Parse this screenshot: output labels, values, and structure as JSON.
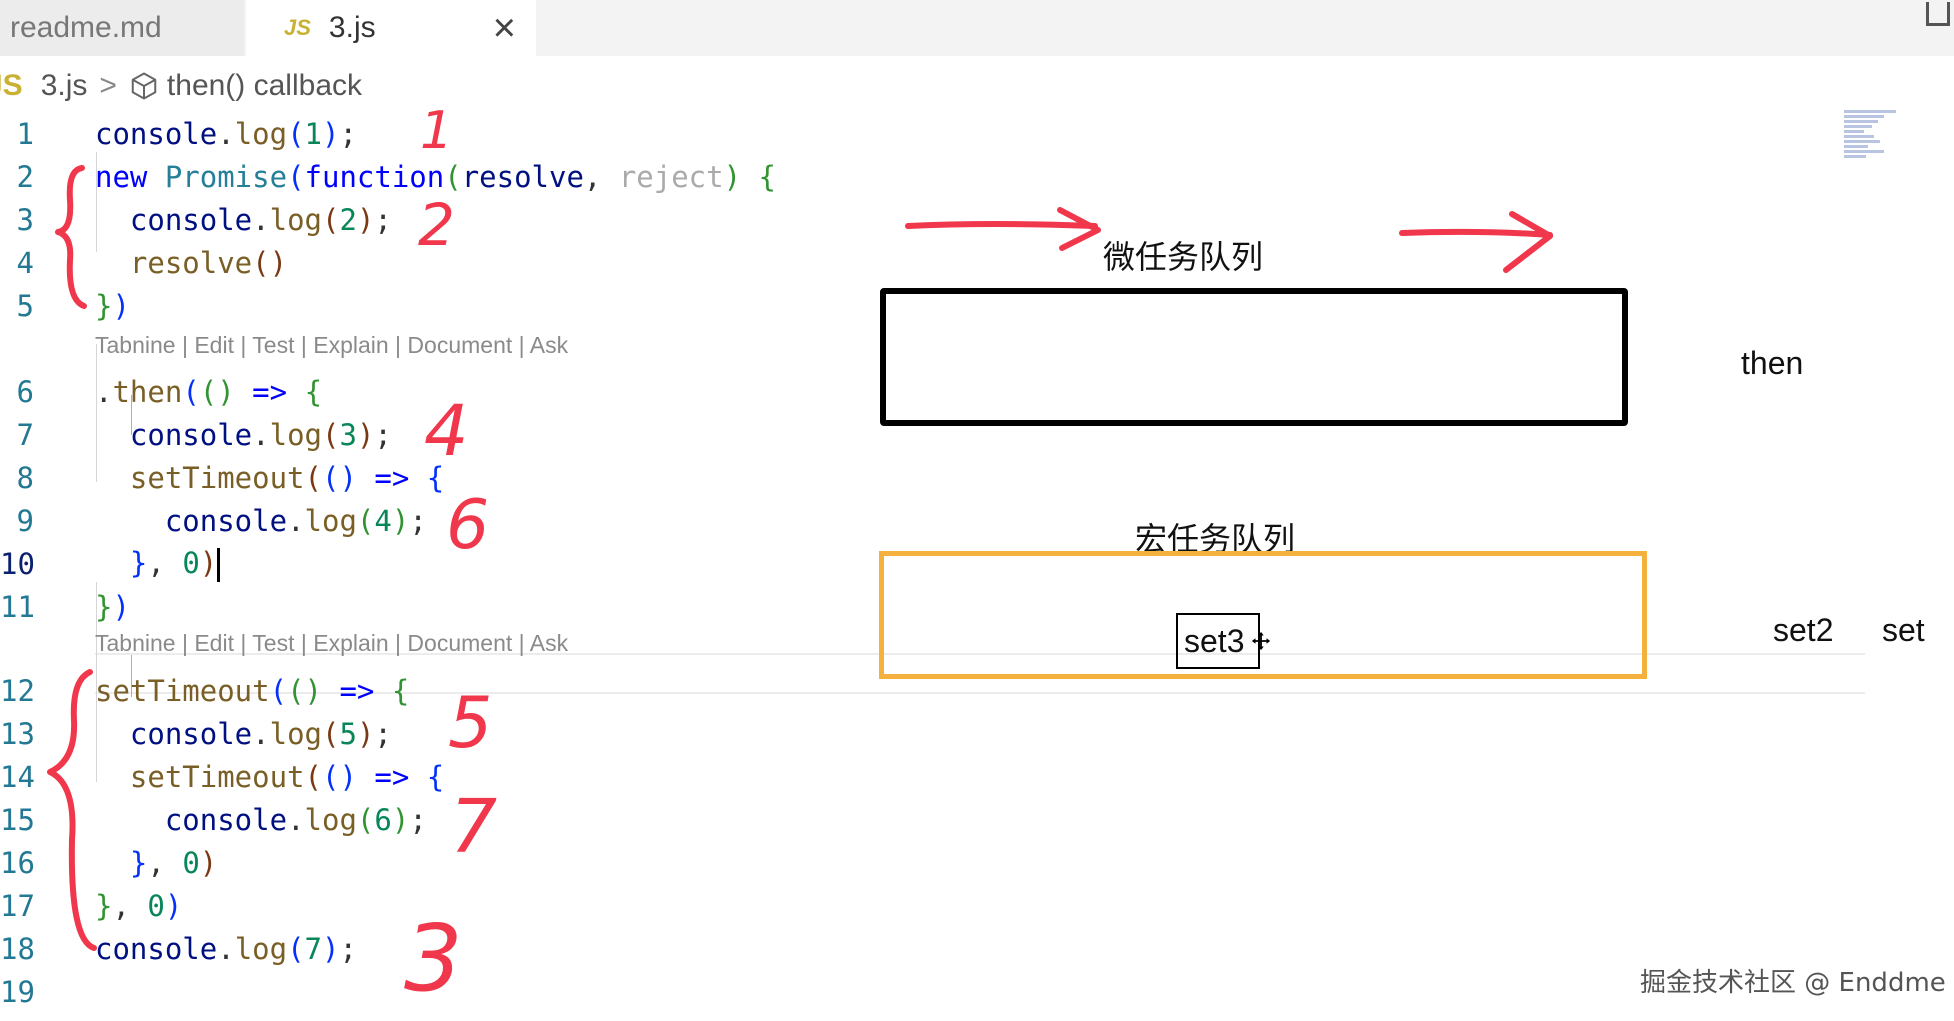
{
  "tabs": [
    {
      "label": "readme.md"
    },
    {
      "badge": "JS",
      "label": "3.js",
      "close": "×"
    }
  ],
  "breadcrumb": {
    "badge": "JS",
    "file": "3.js",
    "separator": ">",
    "symbol": "then() callback"
  },
  "codelens": "Tabnine | Edit | Test | Explain | Document | Ask",
  "line_numbers": [
    "1",
    "2",
    "3",
    "4",
    "5",
    "6",
    "7",
    "8",
    "9",
    "10",
    "11",
    "12",
    "13",
    "14",
    "15",
    "16",
    "17",
    "18",
    "19"
  ],
  "code_lines": [
    {
      "n": 1,
      "tokens": [
        [
          "v",
          "console"
        ],
        [
          "d",
          "."
        ],
        [
          "f",
          "log"
        ],
        [
          "br1",
          "("
        ],
        [
          "n",
          "1"
        ],
        [
          "br1",
          ")"
        ],
        [
          "d",
          ";"
        ]
      ]
    },
    {
      "n": 2,
      "tokens": [
        [
          "k",
          "new "
        ],
        [
          "t",
          "Promise"
        ],
        [
          "br1",
          "("
        ],
        [
          "k",
          "function"
        ],
        [
          "br2",
          "("
        ],
        [
          "v",
          "resolve"
        ],
        [
          "d",
          ", "
        ],
        [
          "p",
          "reject"
        ],
        [
          "br2",
          ")"
        ],
        [
          "d",
          " "
        ],
        [
          "br2",
          "{"
        ]
      ]
    },
    {
      "n": 3,
      "tokens": [
        [
          "d",
          "  "
        ],
        [
          "v",
          "console"
        ],
        [
          "d",
          "."
        ],
        [
          "f",
          "log"
        ],
        [
          "br3",
          "("
        ],
        [
          "n",
          "2"
        ],
        [
          "br3",
          ")"
        ],
        [
          "d",
          ";"
        ]
      ]
    },
    {
      "n": 4,
      "tokens": [
        [
          "d",
          "  "
        ],
        [
          "f",
          "resolve"
        ],
        [
          "br3",
          "()"
        ]
      ]
    },
    {
      "n": 5,
      "tokens": [
        [
          "br2",
          "}"
        ],
        [
          "br1",
          ")"
        ]
      ]
    },
    {
      "n": 6,
      "tokens": [
        [
          "d",
          "."
        ],
        [
          "f",
          "then"
        ],
        [
          "br1",
          "("
        ],
        [
          "br2",
          "()"
        ],
        [
          "d",
          " "
        ],
        [
          "k",
          "=>"
        ],
        [
          "d",
          " "
        ],
        [
          "br2",
          "{"
        ]
      ]
    },
    {
      "n": 7,
      "tokens": [
        [
          "d",
          "  "
        ],
        [
          "v",
          "console"
        ],
        [
          "d",
          "."
        ],
        [
          "f",
          "log"
        ],
        [
          "br3",
          "("
        ],
        [
          "n",
          "3"
        ],
        [
          "br3",
          ")"
        ],
        [
          "d",
          ";"
        ]
      ]
    },
    {
      "n": 8,
      "tokens": [
        [
          "d",
          "  "
        ],
        [
          "f",
          "setTimeout"
        ],
        [
          "br3",
          "("
        ],
        [
          "br1",
          "()"
        ],
        [
          "d",
          " "
        ],
        [
          "k",
          "=>"
        ],
        [
          "d",
          " "
        ],
        [
          "br1",
          "{"
        ]
      ]
    },
    {
      "n": 9,
      "tokens": [
        [
          "d",
          "    "
        ],
        [
          "v",
          "console"
        ],
        [
          "d",
          "."
        ],
        [
          "f",
          "log"
        ],
        [
          "br2",
          "("
        ],
        [
          "n",
          "4"
        ],
        [
          "br2",
          ")"
        ],
        [
          "d",
          ";"
        ]
      ]
    },
    {
      "n": 10,
      "tokens": [
        [
          "d",
          "  "
        ],
        [
          "br1",
          "}"
        ],
        [
          "d",
          ", "
        ],
        [
          "n",
          "0"
        ],
        [
          "br3",
          ")"
        ]
      ]
    },
    {
      "n": 11,
      "tokens": [
        [
          "br2",
          "}"
        ],
        [
          "br1",
          ")"
        ]
      ]
    },
    {
      "n": 12,
      "tokens": [
        [
          "f",
          "setTimeout"
        ],
        [
          "br1",
          "("
        ],
        [
          "br2",
          "()"
        ],
        [
          "d",
          " "
        ],
        [
          "k",
          "=>"
        ],
        [
          "d",
          " "
        ],
        [
          "br2",
          "{"
        ]
      ]
    },
    {
      "n": 13,
      "tokens": [
        [
          "d",
          "  "
        ],
        [
          "v",
          "console"
        ],
        [
          "d",
          "."
        ],
        [
          "f",
          "log"
        ],
        [
          "br3",
          "("
        ],
        [
          "n",
          "5"
        ],
        [
          "br3",
          ")"
        ],
        [
          "d",
          ";"
        ]
      ]
    },
    {
      "n": 14,
      "tokens": [
        [
          "d",
          "  "
        ],
        [
          "f",
          "setTimeout"
        ],
        [
          "br3",
          "("
        ],
        [
          "br1",
          "()"
        ],
        [
          "d",
          " "
        ],
        [
          "k",
          "=>"
        ],
        [
          "d",
          " "
        ],
        [
          "br1",
          "{"
        ]
      ]
    },
    {
      "n": 15,
      "tokens": [
        [
          "d",
          "    "
        ],
        [
          "v",
          "console"
        ],
        [
          "d",
          "."
        ],
        [
          "f",
          "log"
        ],
        [
          "br2",
          "("
        ],
        [
          "n",
          "6"
        ],
        [
          "br2",
          ")"
        ],
        [
          "d",
          ";"
        ]
      ]
    },
    {
      "n": 16,
      "tokens": [
        [
          "d",
          "  "
        ],
        [
          "br1",
          "}"
        ],
        [
          "d",
          ", "
        ],
        [
          "n",
          "0"
        ],
        [
          "br3",
          ")"
        ]
      ]
    },
    {
      "n": 17,
      "tokens": [
        [
          "br2",
          "}"
        ],
        [
          "d",
          ", "
        ],
        [
          "n",
          "0"
        ],
        [
          "br1",
          ")"
        ]
      ]
    },
    {
      "n": 18,
      "tokens": [
        [
          "v",
          "console"
        ],
        [
          "d",
          "."
        ],
        [
          "f",
          "log"
        ],
        [
          "br1",
          "("
        ],
        [
          "n",
          "7"
        ],
        [
          "br1",
          ")"
        ],
        [
          "d",
          ";"
        ]
      ]
    },
    {
      "n": 19,
      "tokens": []
    }
  ],
  "diagram": {
    "microtask_label": "微任务队列",
    "macrotask_label": "宏任务队列",
    "macrotask_item": "set3",
    "then_label": "then",
    "set2_label": "set2",
    "set_label": "set"
  },
  "handwritten_numbers": [
    "1",
    "2",
    "3",
    "4",
    "5",
    "6",
    "7"
  ],
  "watermark": "掘金技术社区 @ Enddme",
  "colors": {
    "annotation_red": "#f0374b",
    "macrotask_border": "#f5b13d",
    "microtask_border": "#000000"
  }
}
